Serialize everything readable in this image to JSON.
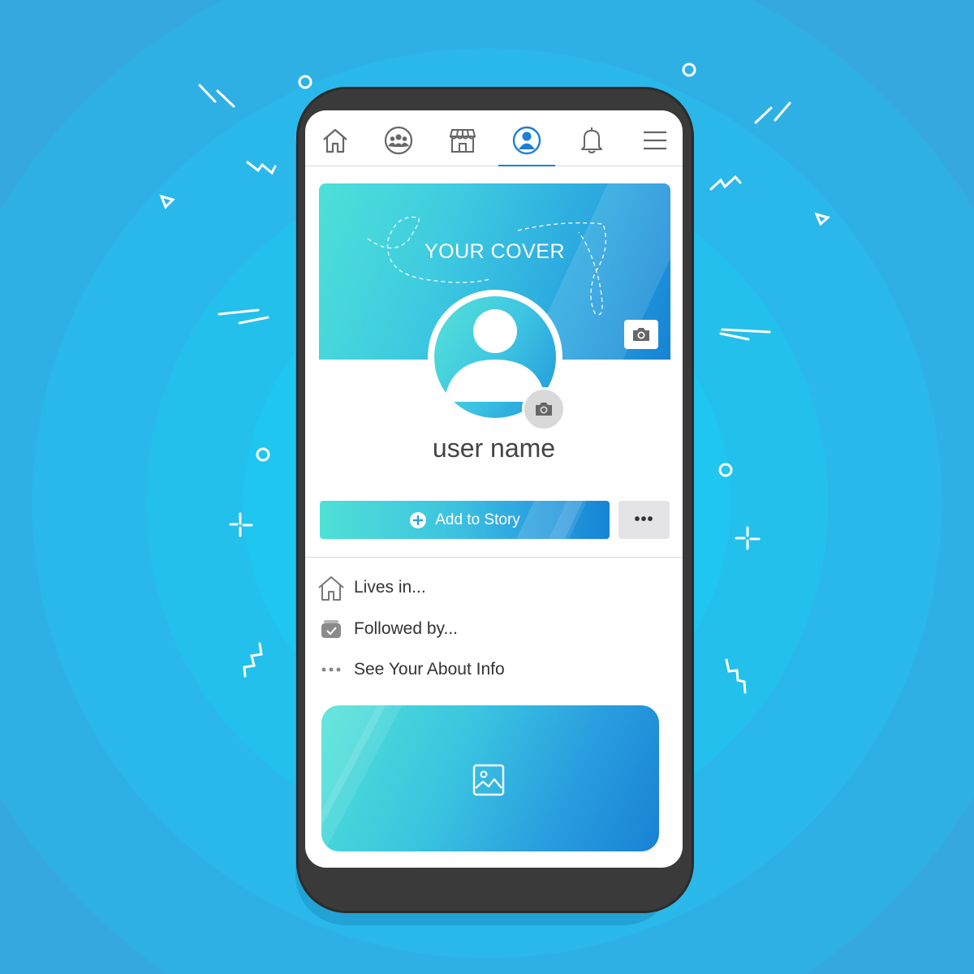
{
  "nav": {
    "items": [
      {
        "icon": "home-icon",
        "active": false
      },
      {
        "icon": "groups-icon",
        "active": false
      },
      {
        "icon": "marketplace-icon",
        "active": false
      },
      {
        "icon": "profile-icon",
        "active": true
      },
      {
        "icon": "bell-icon",
        "active": false
      },
      {
        "icon": "menu-icon",
        "active": false
      }
    ]
  },
  "cover": {
    "title": "YOUR COVER",
    "camera_icon": "camera-icon"
  },
  "profile": {
    "username": "user name",
    "avatar_icon": "person-icon",
    "camera_icon": "camera-icon"
  },
  "actions": {
    "add_story_label": "Add to Story",
    "add_story_icon": "plus-circle-icon",
    "more_label": "•••"
  },
  "about": {
    "items": [
      {
        "icon": "home-icon",
        "label": "Lives in..."
      },
      {
        "icon": "followed-icon",
        "label": "Followed by..."
      },
      {
        "icon": "ellipsis-icon",
        "label": "See Your About Info"
      }
    ]
  },
  "photo_card": {
    "icon": "image-icon"
  },
  "colors": {
    "background": "#2bbde9",
    "accent": "#1a7fd6",
    "teal": "#4de0d8",
    "phone_body": "#3a3a3a",
    "text": "#444444"
  }
}
